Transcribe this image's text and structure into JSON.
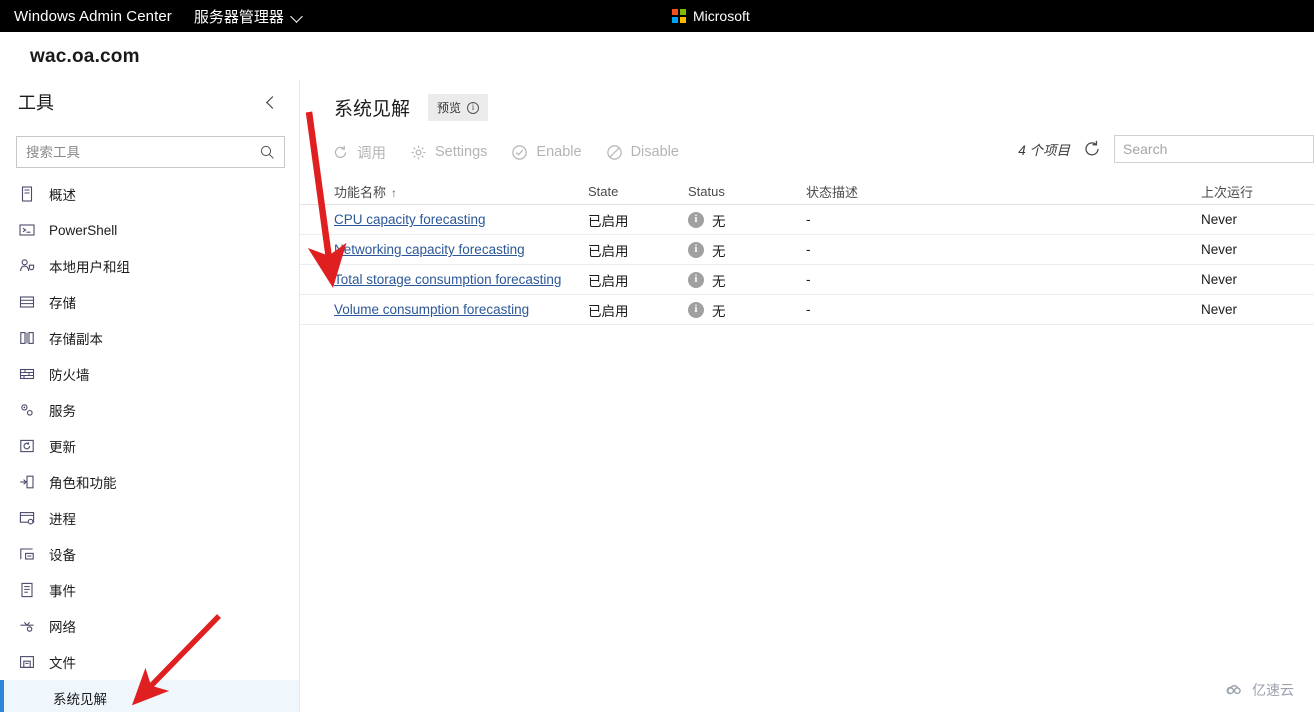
{
  "topbar": {
    "product": "Windows Admin Center",
    "app": "服务器管理器",
    "chevron_icon": "chevron-down-icon",
    "microsoft": "Microsoft",
    "logo_colors": [
      "#f25022",
      "#7fba00",
      "#00a4ef",
      "#ffb900"
    ],
    "background": "#000000"
  },
  "host": {
    "title": "wac.oa.com"
  },
  "sidebar": {
    "title": "工具",
    "collapse_icon": "chevron-left-icon",
    "search": {
      "placeholder": "搜索工具",
      "value": "",
      "icon": "search-icon"
    },
    "items": [
      {
        "label": "概述",
        "icon": "overview-icon"
      },
      {
        "label": "PowerShell",
        "icon": "terminal-icon"
      },
      {
        "label": "本地用户和组",
        "icon": "users-icon"
      },
      {
        "label": "存储",
        "icon": "storage-icon"
      },
      {
        "label": "存储副本",
        "icon": "storage-replica-icon"
      },
      {
        "label": "防火墙",
        "icon": "firewall-icon"
      },
      {
        "label": "服务",
        "icon": "services-icon"
      },
      {
        "label": "更新",
        "icon": "update-icon"
      },
      {
        "label": "角色和功能",
        "icon": "roles-features-icon"
      },
      {
        "label": "进程",
        "icon": "processes-icon"
      },
      {
        "label": "设备",
        "icon": "devices-icon"
      },
      {
        "label": "事件",
        "icon": "events-icon"
      },
      {
        "label": "网络",
        "icon": "network-icon"
      },
      {
        "label": "文件",
        "icon": "files-icon"
      },
      {
        "label": "系统见解",
        "icon": "",
        "selected": true
      }
    ],
    "selected_accent": "#2b88d8",
    "selected_bg": "#eff6fc"
  },
  "main": {
    "title": "系统见解",
    "preview_badge": {
      "label": "预览",
      "icon": "info-icon"
    },
    "toolbar": [
      {
        "label": "调用",
        "icon": "invoke-refresh-icon",
        "disabled": true
      },
      {
        "label": "Settings",
        "icon": "gear-icon",
        "disabled": true
      },
      {
        "label": "Enable",
        "icon": "check-circle-icon",
        "disabled": true
      },
      {
        "label": "Disable",
        "icon": "block-circle-icon",
        "disabled": true
      }
    ],
    "items_count": "4 个项目",
    "refresh_icon": "refresh-icon",
    "search": {
      "placeholder": "Search",
      "value": "",
      "icon": "search-icon"
    },
    "table": {
      "columns": [
        {
          "key": "name",
          "label": "功能名称",
          "sorted": "asc",
          "sort_icon": "arrow-up-icon"
        },
        {
          "key": "state",
          "label": "State"
        },
        {
          "key": "status",
          "label": "Status"
        },
        {
          "key": "desc",
          "label": "状态描述"
        },
        {
          "key": "last",
          "label": "上次运行"
        }
      ],
      "rows": [
        {
          "name": "CPU capacity forecasting",
          "state": "已启用",
          "status": "无",
          "status_icon": "info-circle-icon",
          "desc": "-",
          "last": "Never"
        },
        {
          "name": "Networking capacity forecasting",
          "state": "已启用",
          "status": "无",
          "status_icon": "info-circle-icon",
          "desc": "-",
          "last": "Never"
        },
        {
          "name": "Total storage consumption forecasting",
          "state": "已启用",
          "status": "无",
          "status_icon": "info-circle-icon",
          "desc": "-",
          "last": "Never"
        },
        {
          "name": "Volume consumption forecasting",
          "state": "已启用",
          "status": "无",
          "status_icon": "info-circle-icon",
          "desc": "-",
          "last": "Never"
        }
      ]
    }
  },
  "annotations": {
    "arrow_color": "#e02020",
    "count": 2
  },
  "watermark": {
    "text": "亿速云",
    "icon": "cloud-icon",
    "color": "#9aa2ad"
  }
}
